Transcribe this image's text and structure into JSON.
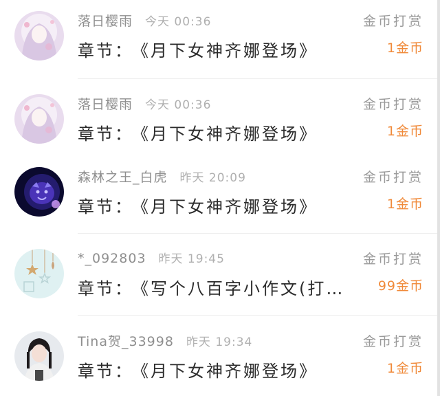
{
  "colors": {
    "accent_orange": "#f08a3a",
    "meta_gray": "#9a9a9a",
    "title_dark": "#2b2b2b"
  },
  "rows": [
    {
      "user": "落日樱雨",
      "time": "今天  00:36",
      "chapter_label": "章节：",
      "chapter_title": "《月下女神齐娜登场》",
      "gift_label": "金币打赏",
      "coins": "1金币",
      "avatar": "anime-girl-avatar"
    },
    {
      "user": "落日樱雨",
      "time": "今天  00:36",
      "chapter_label": "章节：",
      "chapter_title": "《月下女神齐娜登场》",
      "gift_label": "金币打赏",
      "coins": "1金币",
      "avatar": "anime-girl-avatar"
    },
    {
      "user": "森林之王_白虎",
      "time": "昨天  20:09",
      "chapter_label": "章节：",
      "chapter_title": "《月下女神齐娜登场》",
      "gift_label": "金币打赏",
      "coins": "1金币",
      "avatar": "tiger-avatar"
    },
    {
      "user": "*_092803",
      "time": "昨天  19:45",
      "chapter_label": "章节：",
      "chapter_title": "《写个八百字小作文(打…",
      "gift_label": "金币打赏",
      "coins": "99金币",
      "avatar": "star-ornament-avatar"
    },
    {
      "user": "Tina贺_33998",
      "time": "昨天  19:34",
      "chapter_label": "章节：",
      "chapter_title": "《月下女神齐娜登场》",
      "gift_label": "金币打赏",
      "coins": "1金币",
      "avatar": "person-avatar"
    }
  ]
}
